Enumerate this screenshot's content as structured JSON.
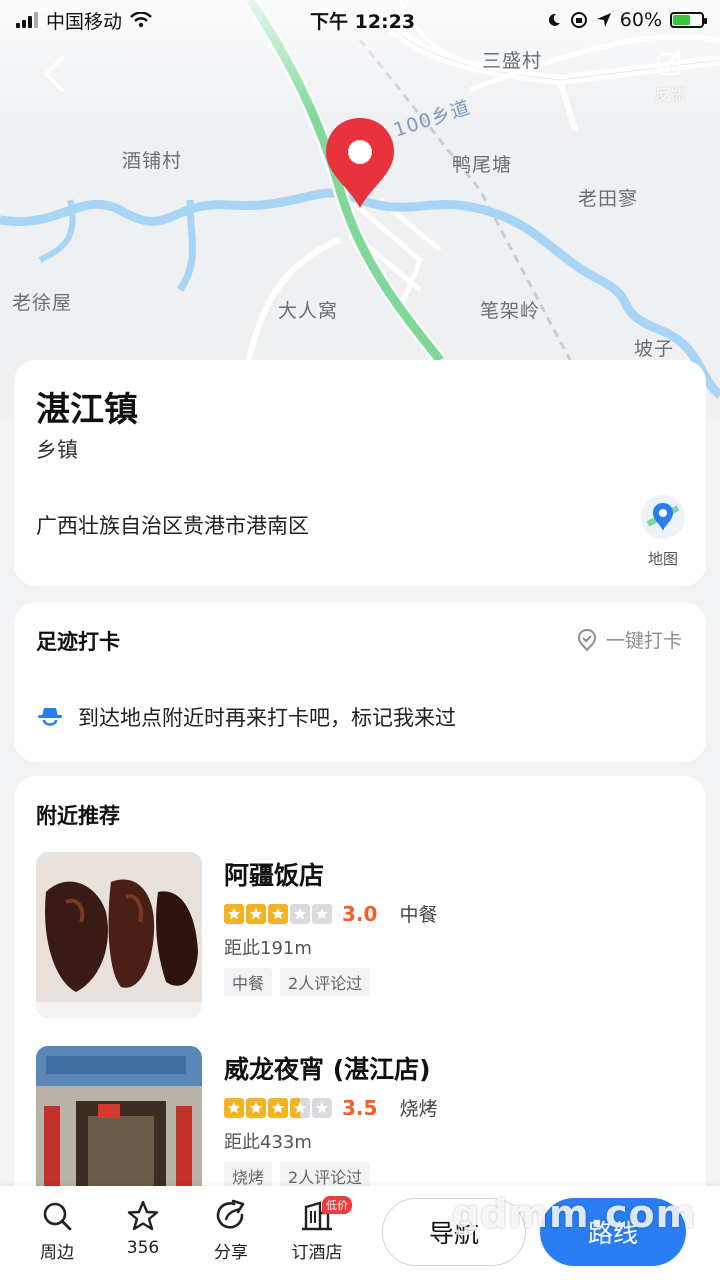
{
  "status_bar": {
    "carrier": "中国移动",
    "time": "下午 12:23",
    "battery": "60%",
    "battery_level": 0.6
  },
  "map": {
    "labels": [
      "三盛村",
      "酒铺村",
      "鸭尾塘",
      "老田寥",
      "大人窝",
      "笔架岭",
      "老徐屋",
      "坡子",
      "100乡道"
    ],
    "feedback_label": "反馈",
    "colors": {
      "river": "#9fd0f3",
      "road_green": "#7fd79a",
      "pin": "#e8333f"
    }
  },
  "place": {
    "title": "湛江镇",
    "type": "乡镇",
    "address": "广西壮族自治区贵港市港南区",
    "map_button_label": "地图"
  },
  "checkin": {
    "title": "足迹打卡",
    "button": "一键打卡",
    "tip": "到达地点附近时再来打卡吧，标记我来过"
  },
  "nearby": {
    "title": "附近推荐",
    "items": [
      {
        "name": "阿疆饭店",
        "rating": 3.0,
        "score": "3.0",
        "category": "中餐",
        "distance": "距此191m",
        "tags": [
          "中餐",
          "2人评论过"
        ]
      },
      {
        "name": "威龙夜宵 (湛江店)",
        "rating": 3.5,
        "score": "3.5",
        "category": "烧烤",
        "distance": "距此433m",
        "tags": [
          "烧烤",
          "2人评论过"
        ]
      }
    ]
  },
  "bottom_bar": {
    "items": [
      {
        "label": "周边",
        "icon": "search-icon"
      },
      {
        "label": "356",
        "icon": "star-icon"
      },
      {
        "label": "分享",
        "icon": "share-icon"
      },
      {
        "label": "订酒店",
        "icon": "hotel-icon",
        "badge": "低价"
      }
    ],
    "nav_label": "导航",
    "route_label": "路线",
    "accent": "#2a7df5"
  },
  "watermark": "gdmm.com"
}
